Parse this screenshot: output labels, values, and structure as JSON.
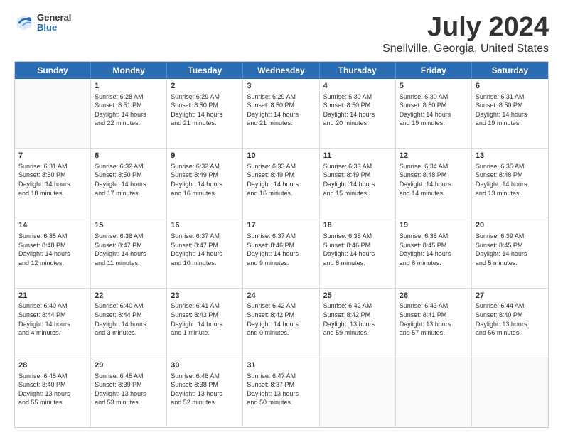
{
  "header": {
    "logo": {
      "line1": "General",
      "line2": "Blue"
    },
    "title": "July 2024",
    "subtitle": "Snellville, Georgia, United States"
  },
  "weekdays": [
    "Sunday",
    "Monday",
    "Tuesday",
    "Wednesday",
    "Thursday",
    "Friday",
    "Saturday"
  ],
  "rows": [
    [
      {
        "day": "",
        "content": ""
      },
      {
        "day": "1",
        "content": "Sunrise: 6:28 AM\nSunset: 8:51 PM\nDaylight: 14 hours\nand 22 minutes."
      },
      {
        "day": "2",
        "content": "Sunrise: 6:29 AM\nSunset: 8:50 PM\nDaylight: 14 hours\nand 21 minutes."
      },
      {
        "day": "3",
        "content": "Sunrise: 6:29 AM\nSunset: 8:50 PM\nDaylight: 14 hours\nand 21 minutes."
      },
      {
        "day": "4",
        "content": "Sunrise: 6:30 AM\nSunset: 8:50 PM\nDaylight: 14 hours\nand 20 minutes."
      },
      {
        "day": "5",
        "content": "Sunrise: 6:30 AM\nSunset: 8:50 PM\nDaylight: 14 hours\nand 19 minutes."
      },
      {
        "day": "6",
        "content": "Sunrise: 6:31 AM\nSunset: 8:50 PM\nDaylight: 14 hours\nand 19 minutes."
      }
    ],
    [
      {
        "day": "7",
        "content": "Sunrise: 6:31 AM\nSunset: 8:50 PM\nDaylight: 14 hours\nand 18 minutes."
      },
      {
        "day": "8",
        "content": "Sunrise: 6:32 AM\nSunset: 8:50 PM\nDaylight: 14 hours\nand 17 minutes."
      },
      {
        "day": "9",
        "content": "Sunrise: 6:32 AM\nSunset: 8:49 PM\nDaylight: 14 hours\nand 16 minutes."
      },
      {
        "day": "10",
        "content": "Sunrise: 6:33 AM\nSunset: 8:49 PM\nDaylight: 14 hours\nand 16 minutes."
      },
      {
        "day": "11",
        "content": "Sunrise: 6:33 AM\nSunset: 8:49 PM\nDaylight: 14 hours\nand 15 minutes."
      },
      {
        "day": "12",
        "content": "Sunrise: 6:34 AM\nSunset: 8:48 PM\nDaylight: 14 hours\nand 14 minutes."
      },
      {
        "day": "13",
        "content": "Sunrise: 6:35 AM\nSunset: 8:48 PM\nDaylight: 14 hours\nand 13 minutes."
      }
    ],
    [
      {
        "day": "14",
        "content": "Sunrise: 6:35 AM\nSunset: 8:48 PM\nDaylight: 14 hours\nand 12 minutes."
      },
      {
        "day": "15",
        "content": "Sunrise: 6:36 AM\nSunset: 8:47 PM\nDaylight: 14 hours\nand 11 minutes."
      },
      {
        "day": "16",
        "content": "Sunrise: 6:37 AM\nSunset: 8:47 PM\nDaylight: 14 hours\nand 10 minutes."
      },
      {
        "day": "17",
        "content": "Sunrise: 6:37 AM\nSunset: 8:46 PM\nDaylight: 14 hours\nand 9 minutes."
      },
      {
        "day": "18",
        "content": "Sunrise: 6:38 AM\nSunset: 8:46 PM\nDaylight: 14 hours\nand 8 minutes."
      },
      {
        "day": "19",
        "content": "Sunrise: 6:38 AM\nSunset: 8:45 PM\nDaylight: 14 hours\nand 6 minutes."
      },
      {
        "day": "20",
        "content": "Sunrise: 6:39 AM\nSunset: 8:45 PM\nDaylight: 14 hours\nand 5 minutes."
      }
    ],
    [
      {
        "day": "21",
        "content": "Sunrise: 6:40 AM\nSunset: 8:44 PM\nDaylight: 14 hours\nand 4 minutes."
      },
      {
        "day": "22",
        "content": "Sunrise: 6:40 AM\nSunset: 8:44 PM\nDaylight: 14 hours\nand 3 minutes."
      },
      {
        "day": "23",
        "content": "Sunrise: 6:41 AM\nSunset: 8:43 PM\nDaylight: 14 hours\nand 1 minute."
      },
      {
        "day": "24",
        "content": "Sunrise: 6:42 AM\nSunset: 8:42 PM\nDaylight: 14 hours\nand 0 minutes."
      },
      {
        "day": "25",
        "content": "Sunrise: 6:42 AM\nSunset: 8:42 PM\nDaylight: 13 hours\nand 59 minutes."
      },
      {
        "day": "26",
        "content": "Sunrise: 6:43 AM\nSunset: 8:41 PM\nDaylight: 13 hours\nand 57 minutes."
      },
      {
        "day": "27",
        "content": "Sunrise: 6:44 AM\nSunset: 8:40 PM\nDaylight: 13 hours\nand 56 minutes."
      }
    ],
    [
      {
        "day": "28",
        "content": "Sunrise: 6:45 AM\nSunset: 8:40 PM\nDaylight: 13 hours\nand 55 minutes."
      },
      {
        "day": "29",
        "content": "Sunrise: 6:45 AM\nSunset: 8:39 PM\nDaylight: 13 hours\nand 53 minutes."
      },
      {
        "day": "30",
        "content": "Sunrise: 6:46 AM\nSunset: 8:38 PM\nDaylight: 13 hours\nand 52 minutes."
      },
      {
        "day": "31",
        "content": "Sunrise: 6:47 AM\nSunset: 8:37 PM\nDaylight: 13 hours\nand 50 minutes."
      },
      {
        "day": "",
        "content": ""
      },
      {
        "day": "",
        "content": ""
      },
      {
        "day": "",
        "content": ""
      }
    ]
  ]
}
